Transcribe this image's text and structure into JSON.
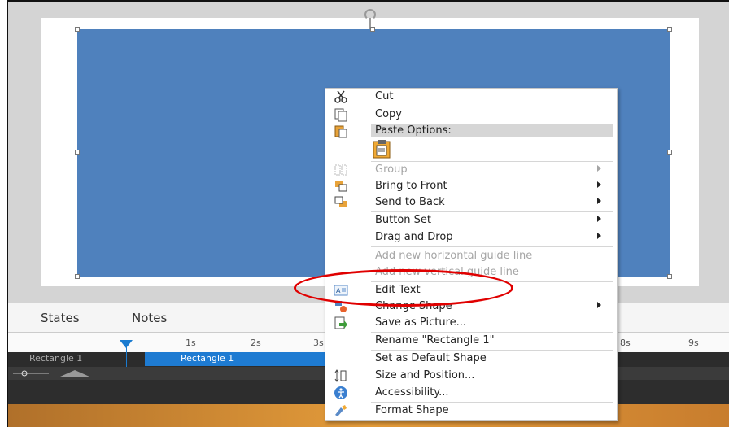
{
  "panel": {
    "tabs": [
      "States",
      "Notes"
    ]
  },
  "timeline": {
    "ticks": [
      "1s",
      "2s",
      "3s",
      "8s",
      "9s"
    ],
    "track_name": "Rectangle 1",
    "track_bar_label": "Rectangle 1"
  },
  "context_menu": {
    "items": [
      {
        "label": "Cut",
        "icon": "scissors-icon",
        "enabled": true,
        "submenu": false
      },
      {
        "label": "Copy",
        "icon": "copy-icon",
        "enabled": true,
        "submenu": false
      },
      {
        "label": "Paste Options:",
        "icon": "paste-icon",
        "enabled": true,
        "submenu": false,
        "header": true
      },
      {
        "label": "Group",
        "icon": "group-icon",
        "enabled": false,
        "submenu": true
      },
      {
        "label": "Bring to Front",
        "icon": "bring-front-icon",
        "enabled": true,
        "submenu": true
      },
      {
        "label": "Send to Back",
        "icon": "send-back-icon",
        "enabled": true,
        "submenu": true
      },
      {
        "label": "Button Set",
        "enabled": true,
        "submenu": true
      },
      {
        "label": "Drag and Drop",
        "enabled": true,
        "submenu": true
      },
      {
        "label": "Add new horizontal guide line",
        "enabled": false,
        "submenu": false
      },
      {
        "label": "Add new vertical guide line",
        "enabled": false,
        "submenu": false
      },
      {
        "label": "Edit Text",
        "icon": "edit-text-icon",
        "enabled": true,
        "submenu": false
      },
      {
        "label": "Change Shape",
        "icon": "change-shape-icon",
        "enabled": true,
        "submenu": true
      },
      {
        "label": "Save as Picture...",
        "icon": "save-picture-icon",
        "enabled": true,
        "submenu": false
      },
      {
        "label": "Rename \"Rectangle 1\"",
        "enabled": true,
        "submenu": false
      },
      {
        "label": "Set as Default Shape",
        "enabled": true,
        "submenu": false
      },
      {
        "label": "Size and Position...",
        "icon": "size-position-icon",
        "enabled": true,
        "submenu": false
      },
      {
        "label": "Accessibility...",
        "icon": "accessibility-icon",
        "enabled": true,
        "submenu": false
      },
      {
        "label": "Format Shape",
        "icon": "format-shape-icon",
        "enabled": true,
        "submenu": false
      }
    ],
    "paste_option_icon": "clipboard-icon"
  },
  "colors": {
    "shape_fill": "#4f81bd",
    "highlight_ellipse": "#e00000",
    "timeline_accent": "#1e7bd2"
  }
}
